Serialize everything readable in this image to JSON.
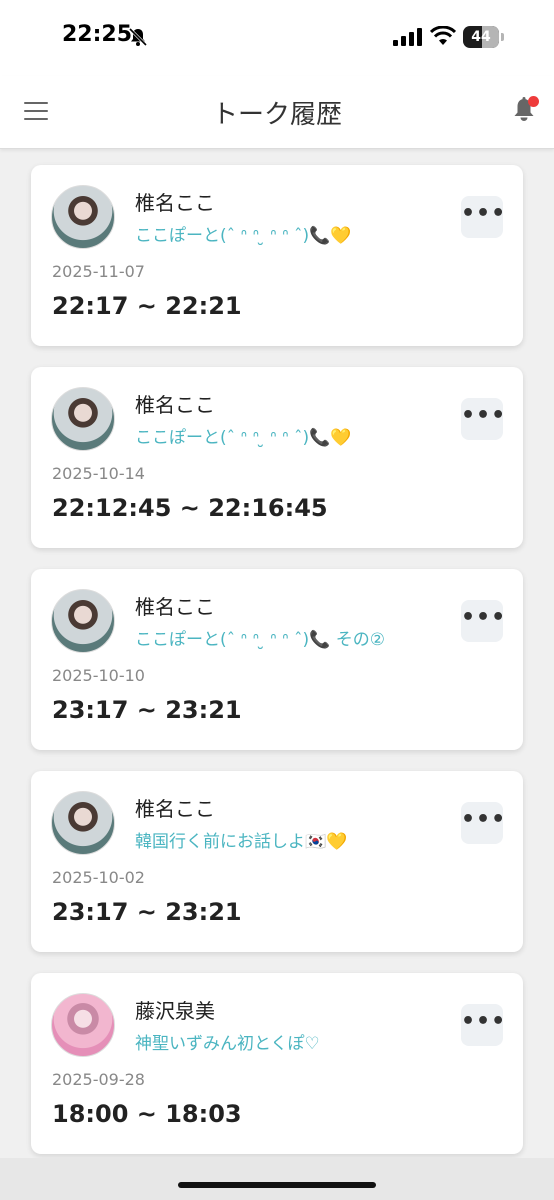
{
  "status_bar": {
    "time": "22:25",
    "battery": "44"
  },
  "header": {
    "title": "トーク履歴"
  },
  "colors": {
    "accent": "#4bb5c1",
    "notification_dot": "#ee3b3b"
  },
  "talks": [
    {
      "name": "椎名ここ",
      "subtitle": "ここぽーと(ˆ ᐢ ᐢ ̮ ᐢ ᐢ ˆ)📞💛",
      "date": "2025-11-07",
      "time": "22:17 ~ 22:21"
    },
    {
      "name": "椎名ここ",
      "subtitle": "ここぽーと(ˆ ᐢ ᐢ ̮ ᐢ ᐢ ˆ)📞💛",
      "date": "2025-10-14",
      "time": "22:12:45 ~ 22:16:45"
    },
    {
      "name": "椎名ここ",
      "subtitle": "ここぽーと(ˆ ᐢ ᐢ ̮ ᐢ ᐢ ˆ)📞 その②",
      "date": "2025-10-10",
      "time": "23:17 ~ 23:21"
    },
    {
      "name": "椎名ここ",
      "subtitle": "韓国行く前にお話しよ🇰🇷💛",
      "date": "2025-10-02",
      "time": "23:17 ~ 23:21"
    },
    {
      "name": "藤沢泉美",
      "subtitle": "神聖いずみん初とくぽ♡",
      "date": "2025-09-28",
      "time": "18:00 ~ 18:03"
    }
  ]
}
